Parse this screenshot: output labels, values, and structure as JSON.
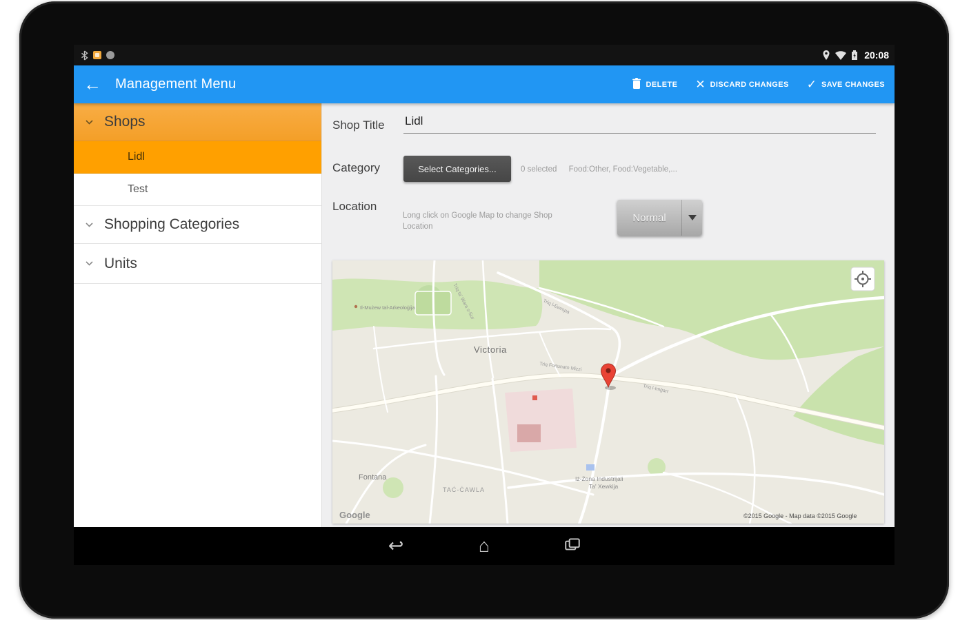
{
  "status_bar": {
    "time": "20:08"
  },
  "app_bar": {
    "title": "Management Menu",
    "actions": [
      {
        "label": "DELETE"
      },
      {
        "label": "DISCARD CHANGES"
      },
      {
        "label": "SAVE CHANGES"
      }
    ]
  },
  "sidebar": {
    "shops_group": "Shops",
    "shop_items": [
      {
        "label": "Lidl"
      },
      {
        "label": "Test"
      }
    ],
    "categories_group": "Shopping Categories",
    "units_group": "Units"
  },
  "form": {
    "shop_title_label": "Shop Title",
    "shop_title_value": "Lidl",
    "category_label": "Category",
    "select_categories_button": "Select Categories...",
    "category_selected_count": "0 selected",
    "category_selected_list": "Food:Other, Food:Vegetable,...",
    "location_label": "Location",
    "location_hint": "Long click on Google Map to change Shop Location",
    "map_type_value": "Normal"
  },
  "map": {
    "labels": {
      "city": "Victoria",
      "village": "Fontana",
      "district": "TAĊ-ĊAWLA",
      "industrial_line1": "Iż-Żona Industrijali",
      "industrial_line2": "Ta' Xewkija",
      "museum": "Il-Mużew tal-Arkeoloġija",
      "street1": "Triq ta' Wara s-Sur",
      "street2": "Triq l-Ewropa",
      "street3": "Triq Fortunato Mizzi",
      "street4": "Triq l-Imġarr"
    },
    "watermark": "Google",
    "copyright": "©2015 Google - Map data ©2015 Google"
  }
}
